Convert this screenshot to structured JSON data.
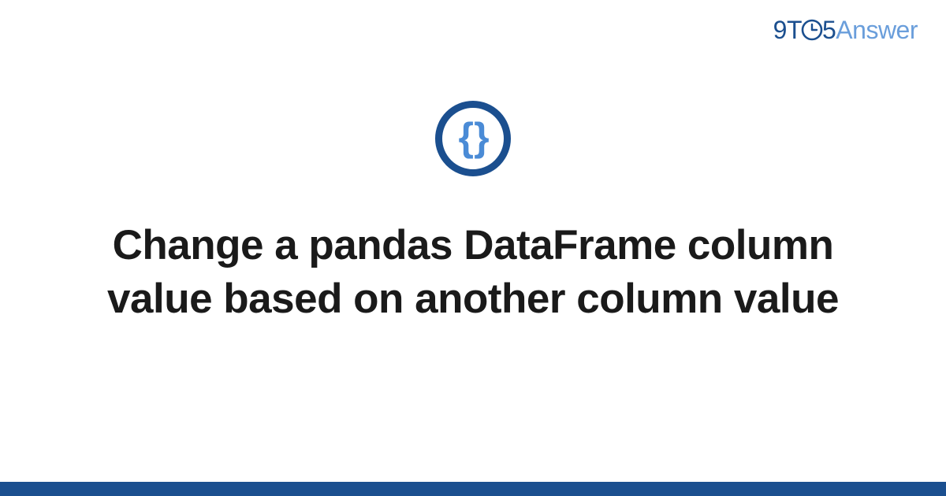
{
  "logo": {
    "nine": "9",
    "t": "T",
    "five": "5",
    "answer": "Answer"
  },
  "icon": {
    "brace_left": "{",
    "brace_right": "}"
  },
  "title": "Change a pandas DataFrame column value based on another column value",
  "colors": {
    "primary": "#1b4f8f",
    "secondary": "#4a8bd6",
    "logo_light": "#6a9edb"
  }
}
